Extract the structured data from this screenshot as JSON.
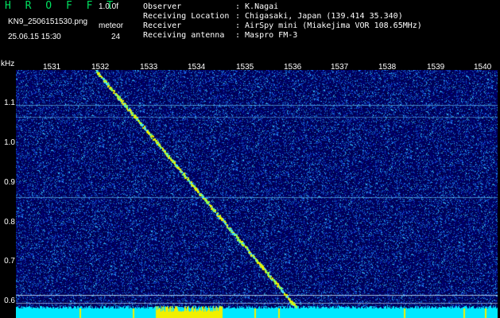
{
  "header": {
    "app_name": "H R O F F T",
    "version": "1.0.0f",
    "filename": "KN9_2506151530.png",
    "datetime": "25.06.15 15:30",
    "meteor_label": "meteor",
    "meteor_count": "24",
    "fields": [
      {
        "label": "Observer",
        "value": ": K.Nagai"
      },
      {
        "label": "Receiving Location",
        "value": ": Chigasaki, Japan (139.414 35.340)"
      },
      {
        "label": "Receiver",
        "value": ": AirSpy mini (Miakejima VOR 108.65MHz)"
      },
      {
        "label": "Receiving antenna",
        "value": ": Maspro FM-3"
      }
    ]
  },
  "axes": {
    "y_unit": "kHz",
    "x_ticks": [
      "1531",
      "1532",
      "1533",
      "1534",
      "1535",
      "1536",
      "1537",
      "1538",
      "1539",
      "1540"
    ],
    "y_ticks": [
      "1.1",
      "1.0",
      "0.9",
      "0.8",
      "0.7",
      "0.6"
    ]
  },
  "colors": {
    "background": "#000000",
    "noise": "#1030c0",
    "trace": "#f0f000",
    "baseline": "#00e8ff",
    "title": "#00e060"
  }
}
